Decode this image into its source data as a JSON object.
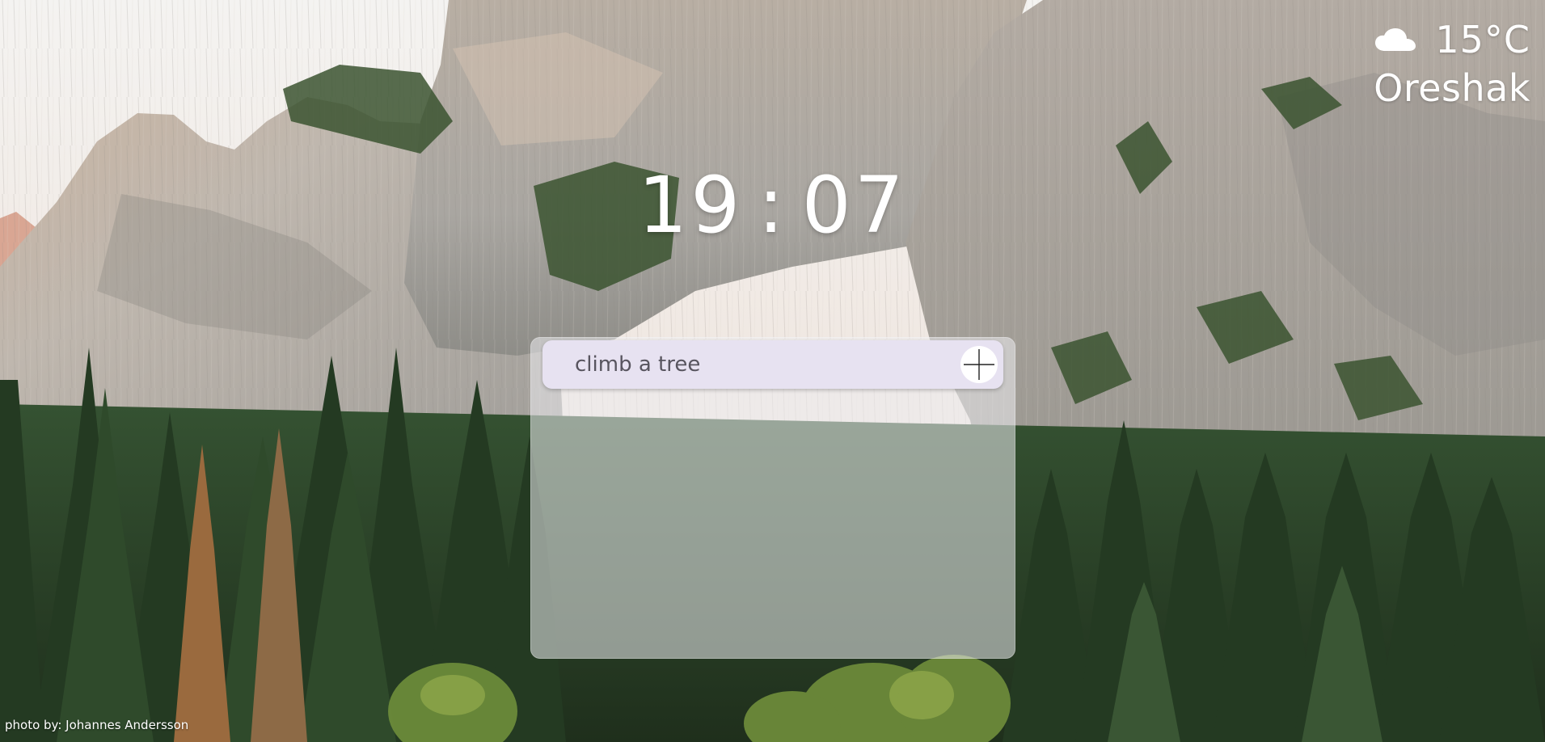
{
  "weather": {
    "icon": "cloud-icon",
    "temperature": "15°C",
    "city": "Oreshak"
  },
  "clock": {
    "hours": "19",
    "separator": ":",
    "minutes": "07"
  },
  "todo": {
    "input_value": "climb a tree",
    "add_icon": "plus-icon"
  },
  "credit": {
    "text": "photo by: Johannes Andersson"
  },
  "colors": {
    "sky": "#f2f0ee",
    "granite": "#b9b5b0",
    "forest": "#2f4a2c",
    "panel": "#ecebf0",
    "input": "#e7e2f1"
  }
}
